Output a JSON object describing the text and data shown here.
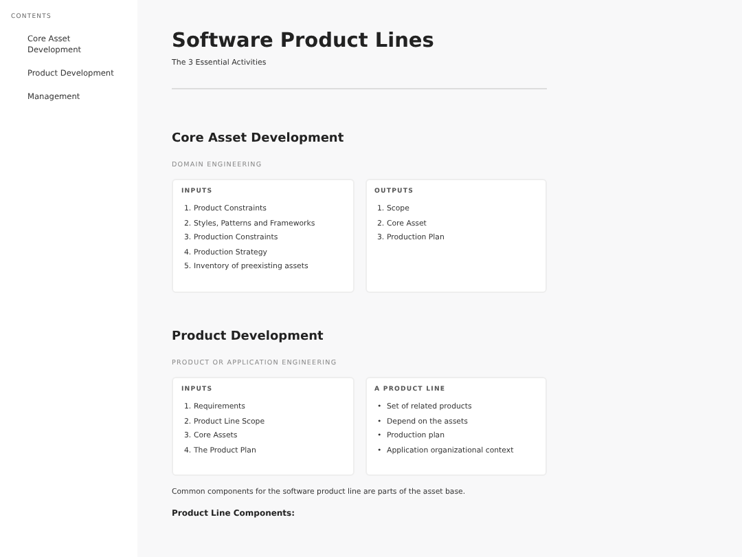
{
  "sidebar": {
    "heading": "CONTENTS",
    "items": [
      {
        "label": "Core Asset Development"
      },
      {
        "label": "Product Development"
      },
      {
        "label": "Management"
      }
    ]
  },
  "header": {
    "title": "Software Product Lines",
    "subtitle": "The 3 Essential Activities"
  },
  "sections": [
    {
      "title": "Core Asset Development",
      "eyebrow": "DOMAIN ENGINEERING",
      "cards": [
        {
          "heading": "INPUTS",
          "items": [
            {
              "marker": "1.",
              "text": "Product Constraints"
            },
            {
              "marker": "2.",
              "text": "Styles, Patterns and Frameworks"
            },
            {
              "marker": "3.",
              "text": "Production Constraints"
            },
            {
              "marker": "4.",
              "text": "Production Strategy"
            },
            {
              "marker": "5.",
              "text": "Inventory of preexisting assets"
            }
          ]
        },
        {
          "heading": "OUTPUTS",
          "items": [
            {
              "marker": "1.",
              "text": "Scope"
            },
            {
              "marker": "2.",
              "text": "Core Asset"
            },
            {
              "marker": "3.",
              "text": "Production Plan"
            }
          ]
        }
      ]
    },
    {
      "title": "Product Development",
      "eyebrow": "PRODUCT OR APPLICATION ENGINEERING",
      "cards": [
        {
          "heading": "INPUTS",
          "items": [
            {
              "marker": "1.",
              "text": "Requirements"
            },
            {
              "marker": "2.",
              "text": "Product Line Scope"
            },
            {
              "marker": "3.",
              "text": "Core Assets"
            },
            {
              "marker": "4.",
              "text": "The Product Plan"
            }
          ]
        },
        {
          "heading": "A PRODUCT LINE",
          "items": [
            {
              "marker": "•",
              "text": "Set of related products"
            },
            {
              "marker": "•",
              "text": "Depend on the assets"
            },
            {
              "marker": "•",
              "text": "Production plan"
            },
            {
              "marker": "•",
              "text": "Application organizational context"
            }
          ]
        }
      ],
      "paragraph": "Common components for the software product line are parts of the asset base.",
      "subheading": "Product Line Components:"
    }
  ]
}
